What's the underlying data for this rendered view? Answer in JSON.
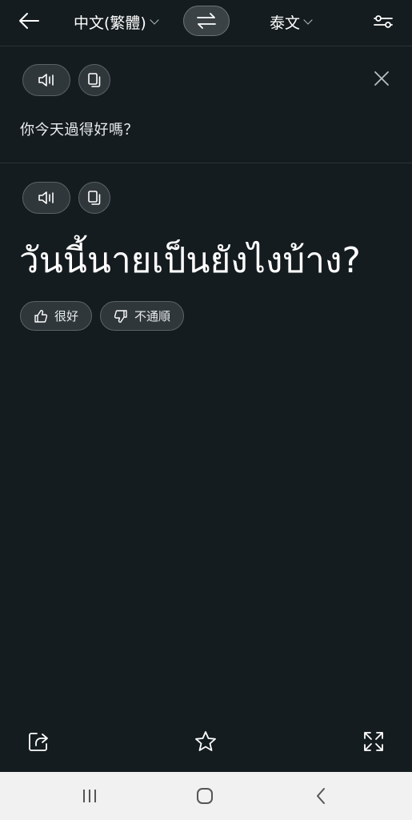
{
  "header": {
    "source_language": "中文(繁體)",
    "target_language": "泰文"
  },
  "source_panel": {
    "text": "你今天過得好嗎？"
  },
  "result_panel": {
    "text": "วันนี้นายเป็นยังไงบ้าง?",
    "feedback": {
      "good_label": "很好",
      "bad_label": "不通順"
    }
  },
  "icons": {
    "back": "arrow-left-icon",
    "swap": "swap-arrows-icon",
    "settings": "sliders-icon",
    "speaker": "speaker-icon",
    "copy": "copy-icon",
    "close": "close-icon",
    "thumbs_up": "thumbs-up-icon",
    "thumbs_down": "thumbs-down-icon",
    "share": "share-icon",
    "star": "star-icon",
    "expand": "expand-icon"
  },
  "colors": {
    "background": "#151c1f",
    "pill_bg": "#2f373b",
    "pill_border": "#5a6367",
    "text": "#ffffff",
    "navbar_bg": "#f1f1f1"
  }
}
